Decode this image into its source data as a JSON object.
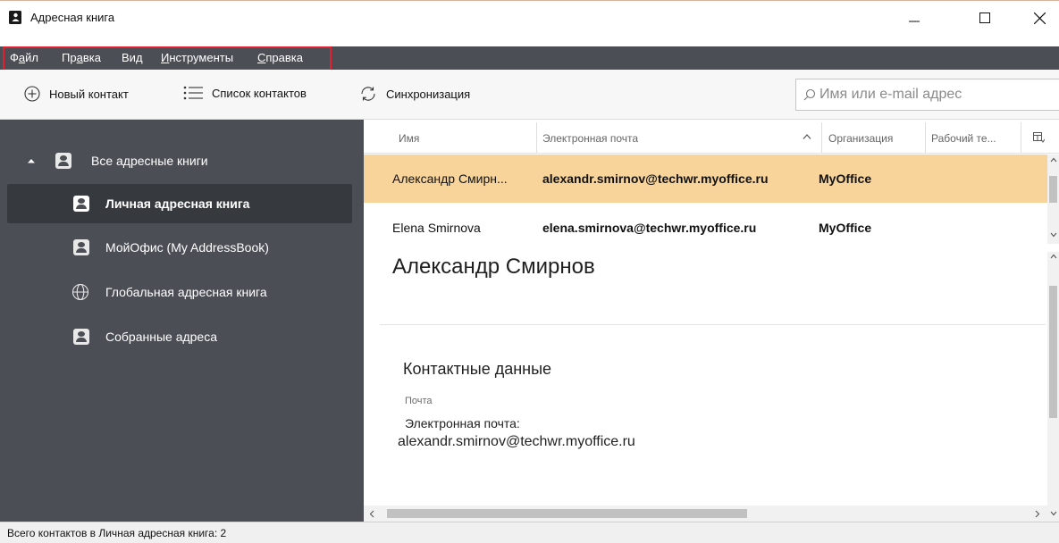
{
  "window": {
    "title": "Адресная книга"
  },
  "menu": {
    "items": [
      {
        "label": "Файл",
        "underline_index": 1
      },
      {
        "label": "Правка",
        "underline_index": 2
      },
      {
        "label": "Вид",
        "underline_index": 2
      },
      {
        "label": "Инструменты",
        "underline_index": 0
      },
      {
        "label": "Справка",
        "underline_index": 0
      }
    ]
  },
  "toolbar": {
    "new_contact": "Новый контакт",
    "contact_list": "Список контактов",
    "sync": "Синхронизация",
    "search_placeholder": "Имя или e-mail адрес"
  },
  "sidebar": {
    "root": "Все адресные книги",
    "items": [
      {
        "label": "Личная адресная книга",
        "selected": true,
        "icon": "address-book-icon"
      },
      {
        "label": "МойОфис (My AddressBook)",
        "selected": false,
        "icon": "address-book-icon"
      },
      {
        "label": "Глобальная адресная книга",
        "selected": false,
        "icon": "globe-icon"
      },
      {
        "label": "Собранные адреса",
        "selected": false,
        "icon": "address-book-icon"
      }
    ]
  },
  "table": {
    "columns": [
      "Имя",
      "Электронная почта",
      "Организация",
      "Рабочий те..."
    ],
    "sort_column": "Электронная почта",
    "rows": [
      {
        "name": "Александр Смирн...",
        "email": "alexandr.smirnov@techwr.myoffice.ru",
        "org": "MyOffice",
        "phone": "",
        "selected": true
      },
      {
        "name": "Elena Smirnova",
        "email": "elena.smirnova@techwr.myoffice.ru",
        "org": "MyOffice",
        "phone": "",
        "selected": false
      }
    ]
  },
  "detail": {
    "name": "Александр Смирнов",
    "section_title": "Контактные данные",
    "group_label": "Почта",
    "field_label": "Электронная почта:",
    "field_value": "alexandr.smirnov@techwr.myoffice.ru"
  },
  "status": {
    "text": "Всего контактов в Личная адресная книга: 2"
  },
  "colors": {
    "sidebar_bg": "#4b4e54",
    "selected_row": "#f8d49a",
    "menu_highlight": "#e5202e"
  }
}
